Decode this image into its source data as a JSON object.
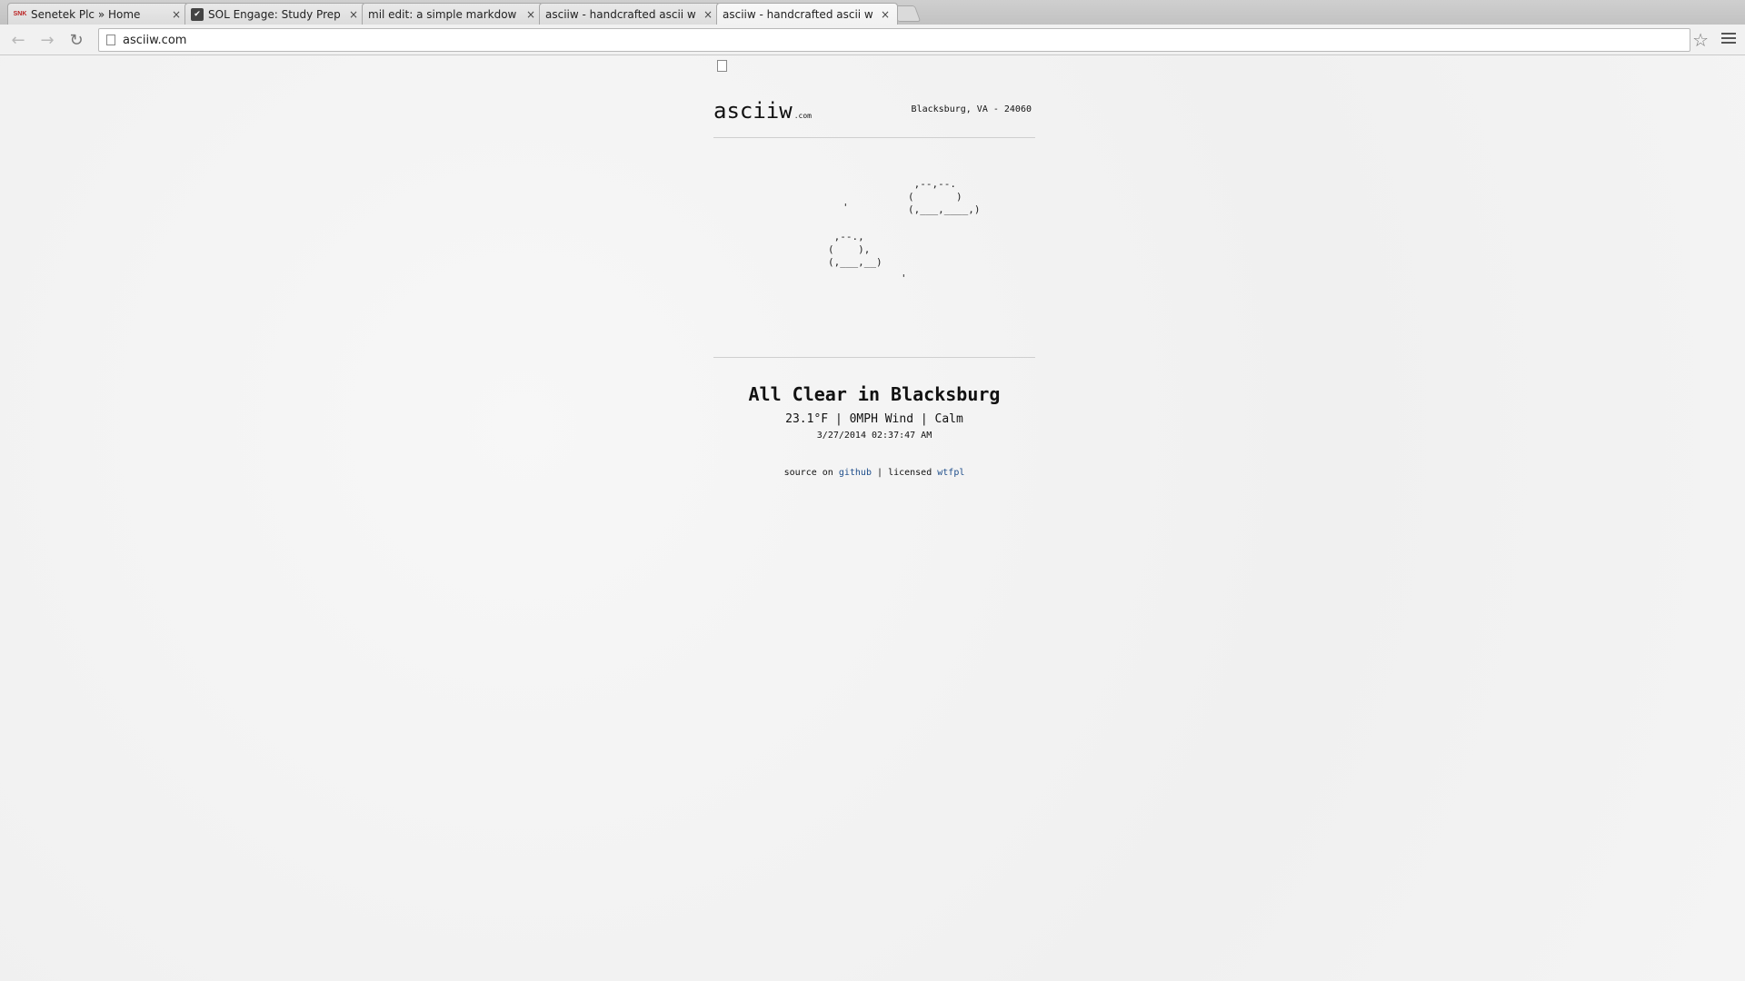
{
  "browser": {
    "tabs": [
      {
        "title": "Senetek Plc » Home",
        "favicon": "SNK"
      },
      {
        "title": "SOL Engage: Study Prep fo",
        "favicon": "✔"
      },
      {
        "title": "mil edit: a simple markdow",
        "favicon": ""
      },
      {
        "title": "asciiw - handcrafted ascii w",
        "favicon": ""
      },
      {
        "title": "asciiw - handcrafted ascii w",
        "favicon": ""
      }
    ],
    "close_glyph": "×",
    "url": "asciiw.com"
  },
  "site": {
    "logo": "asciiw",
    "logo_tld": ".com",
    "location": "Blacksburg, VA - 24060"
  },
  "art": {
    "cloud_large": " ,--,--.\n(       )\n(,___,____,)",
    "cloud_small": " ,--.,\n(    ),\n(,___,__)",
    "drop_1": "'",
    "drop_2": "'"
  },
  "weather": {
    "headline": "All Clear in Blacksburg",
    "stats": "23.1°F | 0MPH Wind | Calm",
    "timestamp": "3/27/2014 02:37:47 AM"
  },
  "footer": {
    "source_text": "source on",
    "github_link": "github",
    "separator": "|",
    "licensed_text": "licensed",
    "license_link": "wtfpl"
  }
}
